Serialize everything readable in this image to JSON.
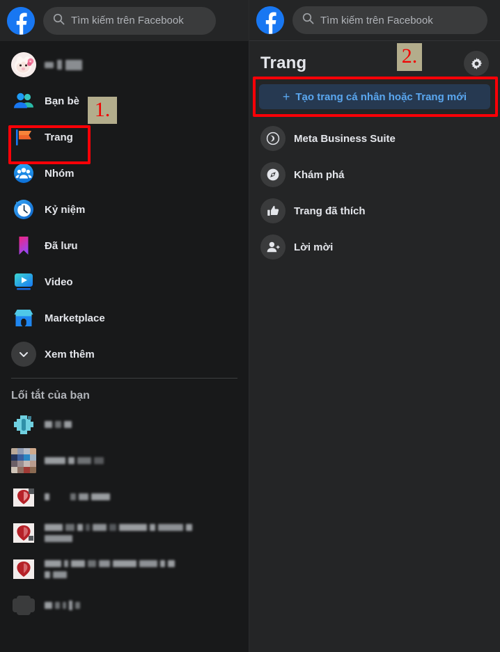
{
  "search": {
    "placeholder": "Tìm kiếm trên Facebook",
    "icon": "search-icon"
  },
  "brand": {
    "logo": "facebook-logo",
    "color": "#1877f2"
  },
  "sidebar": {
    "profile": {
      "name_redacted": true,
      "avatar": "user-avatar"
    },
    "items": [
      {
        "label": "Bạn bè",
        "icon": "friends-icon"
      },
      {
        "label": "Trang",
        "icon": "pages-flag-icon"
      },
      {
        "label": "Nhóm",
        "icon": "groups-icon"
      },
      {
        "label": "Kỷ niệm",
        "icon": "memories-clock-icon"
      },
      {
        "label": "Đã lưu",
        "icon": "saved-bookmark-icon"
      },
      {
        "label": "Video",
        "icon": "video-icon"
      },
      {
        "label": "Marketplace",
        "icon": "marketplace-shop-icon"
      },
      {
        "label": "Xem thêm",
        "icon": "chevron-down-icon"
      }
    ],
    "shortcuts_title": "Lối tắt của bạn",
    "shortcuts": [
      {
        "thumb": "game-shortcut-thumb",
        "label_redacted": true
      },
      {
        "thumb": "palette-shortcut-thumb",
        "label_redacted": true
      },
      {
        "thumb": "group-shortcut-thumb-1",
        "label_redacted": true
      },
      {
        "thumb": "group-shortcut-thumb-2",
        "label_redacted": true
      },
      {
        "thumb": "group-shortcut-thumb-3",
        "label_redacted": true
      },
      {
        "thumb": "dark-shortcut-thumb",
        "label_redacted": true
      }
    ]
  },
  "pages_panel": {
    "title": "Trang",
    "settings_icon": "gear-icon",
    "create_button": {
      "label": "Tạo trang cá nhân hoặc Trang mới",
      "plus": "+",
      "bg": "#263951",
      "fg": "#5aa7f0"
    },
    "items": [
      {
        "label": "Meta Business Suite",
        "icon": "meta-business-suite-icon"
      },
      {
        "label": "Khám phá",
        "icon": "explore-icon"
      },
      {
        "label": "Trang đã thích",
        "icon": "thumbs-up-icon"
      },
      {
        "label": "Lời mời",
        "icon": "invites-person-add-icon"
      }
    ]
  },
  "annotations": {
    "highlight_color": "#fb0007",
    "badge_bg": "#b3ad8c",
    "badge_fg": "#f10000",
    "markers": [
      {
        "text": "1."
      },
      {
        "text": "2."
      }
    ]
  }
}
